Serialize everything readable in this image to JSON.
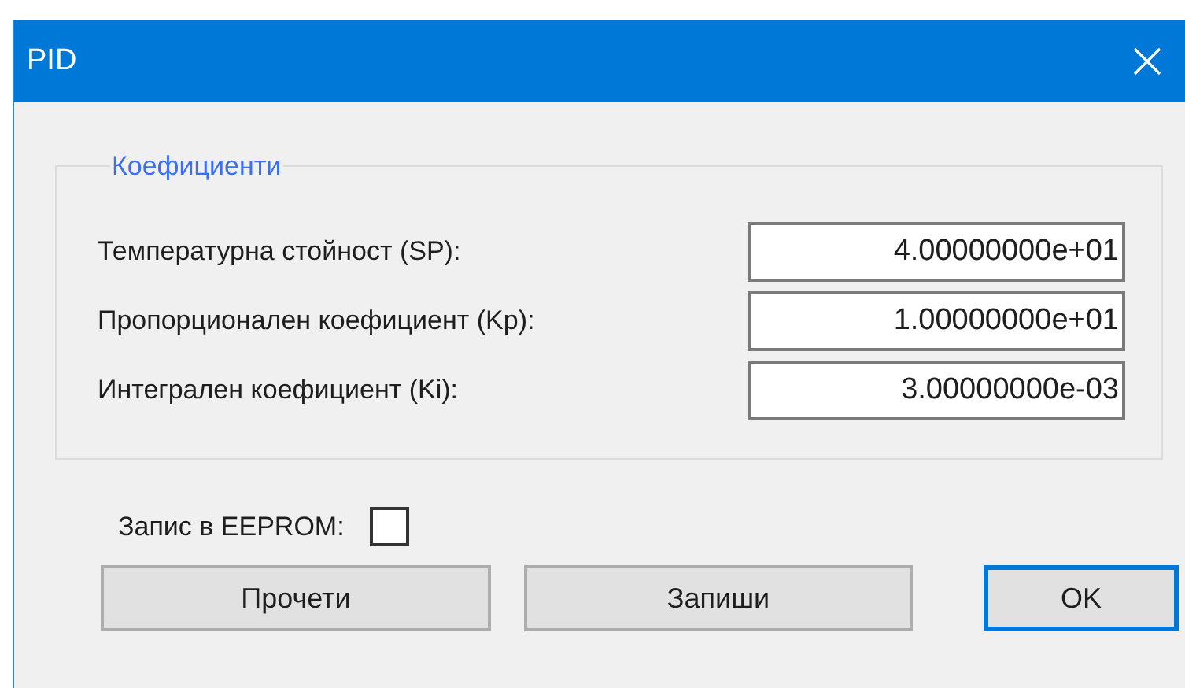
{
  "window": {
    "title": "PID"
  },
  "group": {
    "title": "Коефициенти",
    "fields": [
      {
        "label": "Температурна стойност (SP):",
        "value": "4.00000000e+01"
      },
      {
        "label": "Пропорционален коефициент (Kp):",
        "value": "1.00000000e+01"
      },
      {
        "label": "Интегрален коефициент (Ki):",
        "value": "3.00000000e-03"
      }
    ]
  },
  "eeprom": {
    "label": "Запис в EEPROM:",
    "checked": false
  },
  "buttons": [
    {
      "label": "Прочети",
      "default": false
    },
    {
      "label": "Запиши",
      "default": false
    },
    {
      "label": "OK",
      "default": true
    }
  ]
}
